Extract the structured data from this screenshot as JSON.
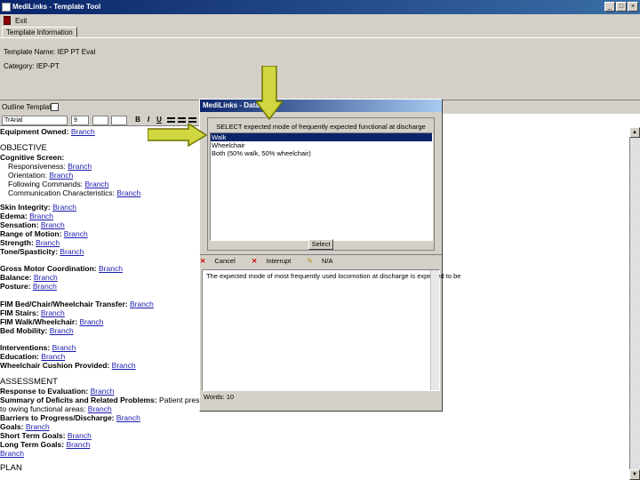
{
  "window": {
    "title": "MediLinks - Template Tool",
    "minimize": "_",
    "maximize": "□",
    "close": "×"
  },
  "menu": {
    "exit_label": "Exit"
  },
  "tab": {
    "label": "Template Information"
  },
  "template": {
    "name_label": "Template Name:",
    "name_value": "IEP PT Eval",
    "category_label": "Category:",
    "category_value": "IEP-PT"
  },
  "outline": {
    "label": "Outline Template"
  },
  "editor": {
    "font": "TrArial",
    "size": "9",
    "bold": "B",
    "italic": "I",
    "underline": "U",
    "doc": {
      "equip_label": "Equipment Owned:",
      "equip_link": "Branch",
      "objective": "OBJECTIVE",
      "cog_label": "Cognitive Screen:",
      "resp_label": "Responsiveness:",
      "resp_link": "Branch",
      "orient_label": "Orientation:",
      "orient_link": "Branch",
      "follow_label": "Following Commands:",
      "follow_link": "Branch",
      "comm_label": "Communication Characteristics:",
      "comm_link": "Branch",
      "skin_label": "Skin Integrity:",
      "skin_link": "Branch",
      "edema_label": "Edema:",
      "edema_link": "Branch",
      "sens_label": "Sensation:",
      "sens_link": "Branch",
      "rom_label": "Range of Motion:",
      "rom_link": "Branch",
      "str_label": "Strength:",
      "str_link": "Branch",
      "tone_label": "Tone/Spasticity:",
      "tone_link": "Branch",
      "gmc_label": "Gross Motor Coordination:",
      "gmc_link": "Branch",
      "bal_label": "Balance:",
      "bal_link": "Branch",
      "pos_label": "Posture:",
      "pos_link": "Branch",
      "fimbed_label": "FIM Bed/Chair/Wheelchair Transfer:",
      "fimbed_link": "Branch",
      "fimstairs_label": "FIM Stairs:",
      "fimstairs_link": "Branch",
      "fimwalk_label": "FIM Walk/Wheelchair:",
      "fimwalk_link": "Branch",
      "bedmob_label": "Bed Mobility:",
      "bedmob_link": "Branch",
      "interv_label": "Interventions:",
      "interv_link": "Branch",
      "edu_label": "Education:",
      "edu_link": "Branch",
      "wcc_label": "Wheelchair Cushion Provided:",
      "wcc_link": "Branch",
      "assessment": "ASSESSMENT",
      "resp_eval_label": "Response to Evaluation:",
      "resp_eval_link": "Branch",
      "summary_label": "Summary of Deficits and Related Problems:",
      "summary_tail": "Patient presents",
      "summary_line2": "to owing functional areas:",
      "summary_link": "Branch",
      "barriers_label": "Barriers to Progress/Discharge:",
      "barriers_link": "Branch",
      "goals_label": "Goals:",
      "goals_link": "Branch",
      "stg_label": "Short Term Goals:",
      "stg_link": "Branch",
      "ltg_label": "Long Term Goals:",
      "ltg_link": "Branch",
      "last_link": "Branch",
      "plan": "PLAN"
    }
  },
  "dialog": {
    "title": "MediLinks - Data Entry",
    "instruction": "SELECT expected mode of frequently expected functional at discharge",
    "items": [
      "Walk",
      "Wheelchair",
      "Both (50% walk, 50% wheelchair)"
    ],
    "select_btn": "Select",
    "cancel": "Cancel",
    "interrupt": "Interrupt",
    "other": "N/A",
    "memo_text": "The expected mode of most frequently used locomotion at discharge is expected to be",
    "status": "Words: 10"
  }
}
